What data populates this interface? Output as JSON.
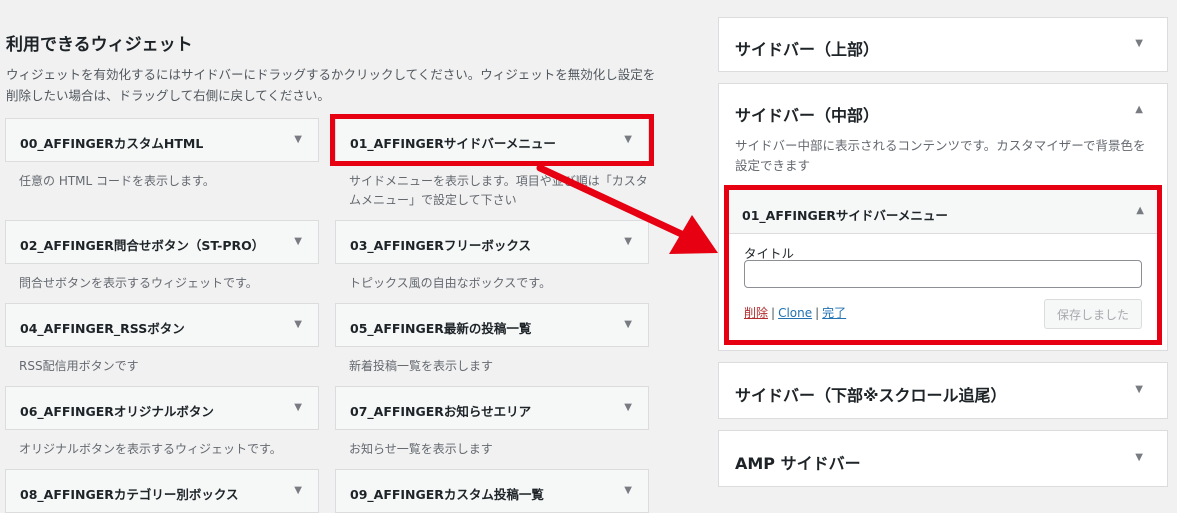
{
  "available": {
    "title": "利用できるウィジェット",
    "description": "ウィジェットを有効化するにはサイドバーにドラッグするかクリックしてください。ウィジェットを無効化し設定を削除したい場合は、ドラッグして右側に戻してください。",
    "widgets": [
      {
        "title": "00_AFFINGERカスタムHTML",
        "desc": "任意の HTML コードを表示します。"
      },
      {
        "title": "01_AFFINGERサイドバーメニュー",
        "desc": "サイドメニューを表示します。項目や並び順は「カスタムメニュー」で設定して下さい"
      },
      {
        "title": "02_AFFINGER問合せボタン（ST-PRO）",
        "desc": "問合せボタンを表示するウィジェットです。"
      },
      {
        "title": "03_AFFINGERフリーボックス",
        "desc": "トピックス風の自由なボックスです。"
      },
      {
        "title": "04_AFFINGER_RSSボタン",
        "desc": "RSS配信用ボタンです"
      },
      {
        "title": "05_AFFINGER最新の投稿一覧",
        "desc": "新着投稿一覧を表示します"
      },
      {
        "title": "06_AFFINGERオリジナルボタン",
        "desc": "オリジナルボタンを表示するウィジェットです。"
      },
      {
        "title": "07_AFFINGERお知らせエリア",
        "desc": "お知らせ一覧を表示します"
      },
      {
        "title": "08_AFFINGERカテゴリー別ボックス",
        "desc": ""
      },
      {
        "title": "09_AFFINGERカスタム投稿一覧",
        "desc": ""
      }
    ]
  },
  "sidebars": [
    {
      "title": "サイドバー（上部）"
    },
    {
      "title": "サイドバー（中部）",
      "description": "サイドバー中部に表示されるコンテンツです。カスタマイザーで背景色を設定できます"
    },
    {
      "title": "サイドバー（下部※スクロール追尾）"
    },
    {
      "title": "AMP サイドバー"
    }
  ],
  "expanded_widget": {
    "title": "01_AFFINGERサイドバーメニュー",
    "field_label": "タイトル",
    "field_value": "",
    "delete_label": "削除",
    "clone_label": "Clone",
    "done_label": "完了",
    "save_label": "保存しました"
  },
  "icons": {
    "collapse": "triangle-down-icon",
    "expand": "triangle-up-icon"
  },
  "colors": {
    "highlight": "#e60012",
    "link": "#2271b1",
    "delete": "#b32d2e"
  }
}
